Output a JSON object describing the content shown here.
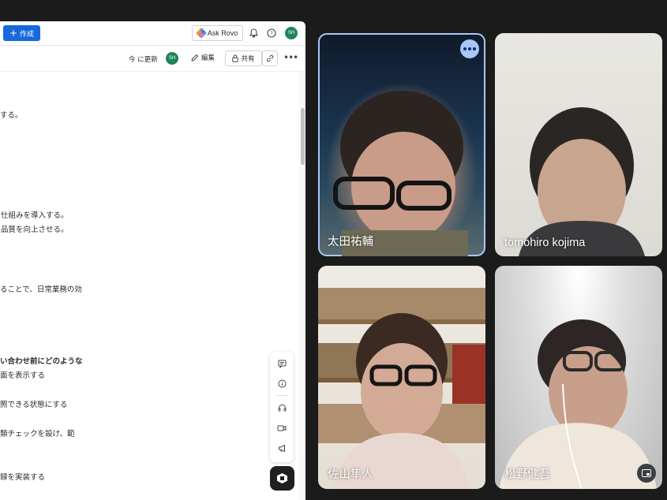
{
  "doc": {
    "toolbar": {
      "create_label": "作成",
      "rovo_label": "Ask Rovo",
      "user_initials": "SH"
    },
    "subbar": {
      "updated_label": "今 に更新",
      "editor_initials": "SH",
      "edit_label": "編集",
      "share_label": "共有"
    },
    "lines": [
      "する。",
      "仕組みを導入する。",
      "品質を向上させる。",
      "ることで、日常業務の効",
      "い合わせ前にどのような",
      "面を表示する",
      "照できる状態にする",
      "類チェックを設け、範",
      "録を実装する"
    ]
  },
  "meeting": {
    "participants": [
      {
        "name": "太田祐輔",
        "speaking": true
      },
      {
        "name": "tomohiro kojima",
        "speaking": false
      },
      {
        "name": "佐山隼人",
        "speaking": false
      },
      {
        "name": "松野健吾",
        "speaking": false
      }
    ],
    "highlight_color": "#a8c7fa"
  }
}
